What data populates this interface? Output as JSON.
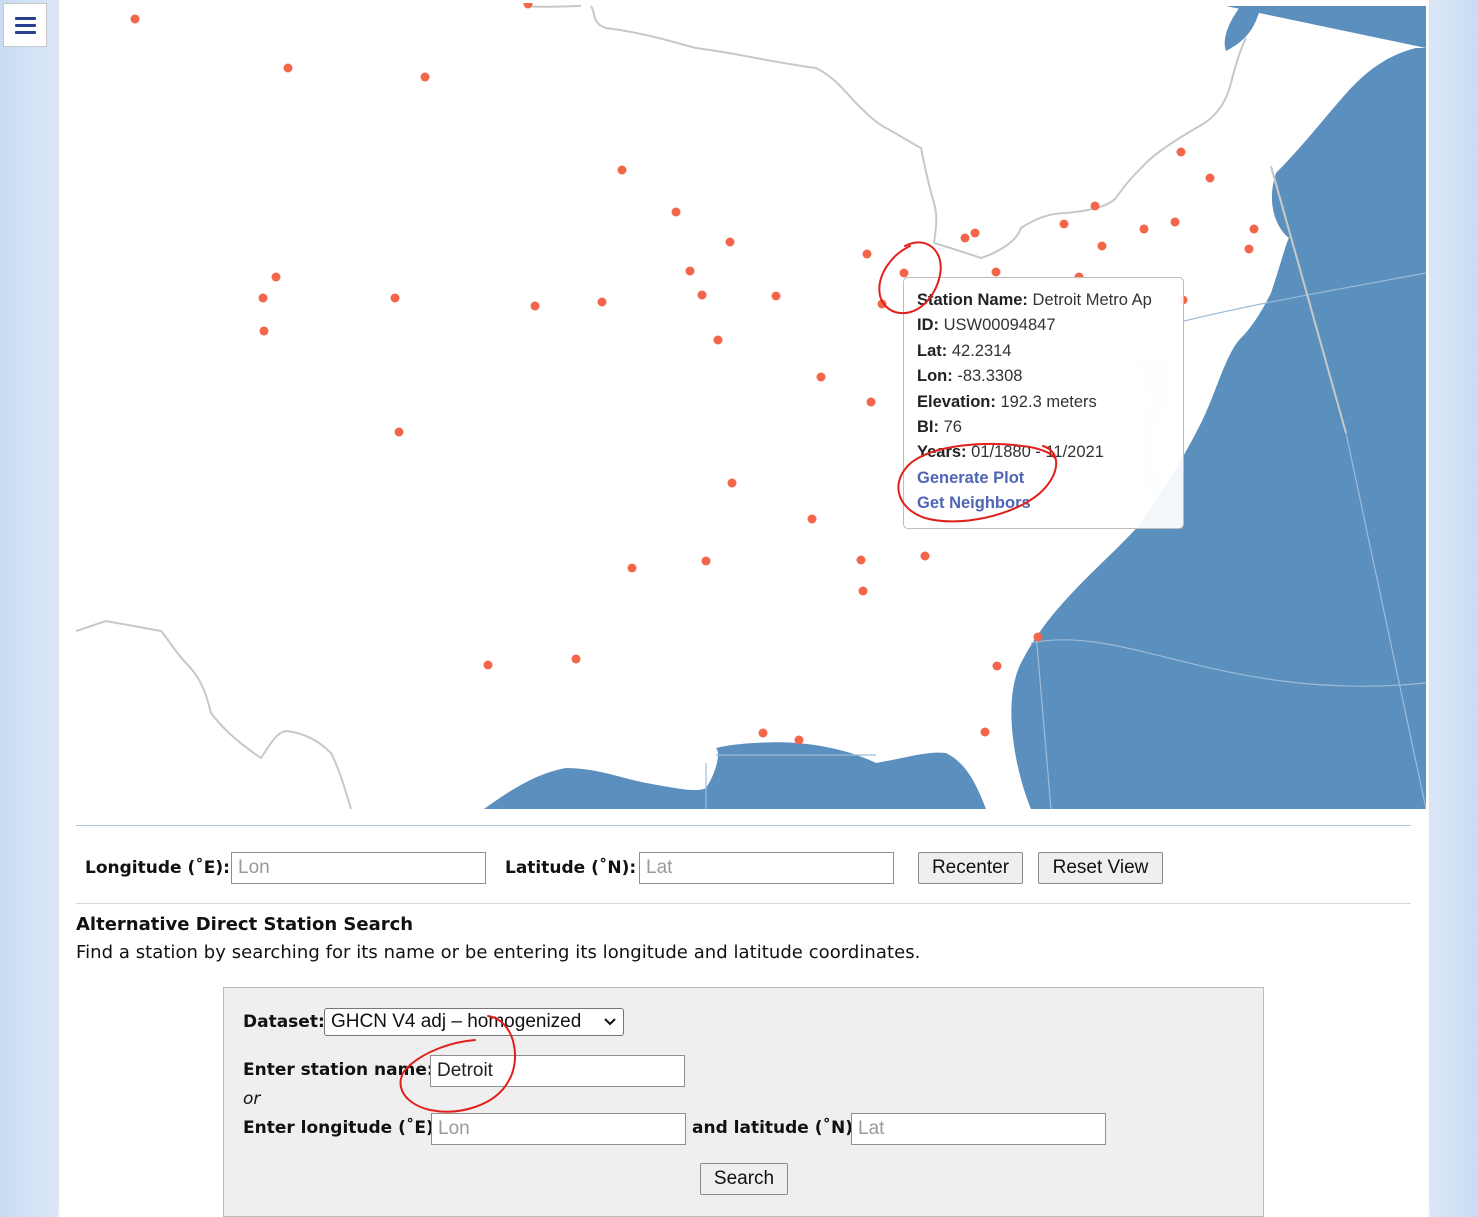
{
  "menu": {
    "icon": "hamburger-menu-icon"
  },
  "map": {
    "land_color": "#ffffff",
    "water_color": "#5b8fbe",
    "border_color": "#c8c8c8",
    "station_color": "#f4664a",
    "popup": {
      "station_name_label": "Station Name:",
      "station_name": "Detroit Metro Ap",
      "id_label": "ID:",
      "id": "USW00094847",
      "lat_label": "Lat:",
      "lat": "42.2314",
      "lon_label": "Lon:",
      "lon": "-83.3308",
      "elevation_label": "Elevation:",
      "elevation": "192.3 meters",
      "bi_label": "BI:",
      "bi": "76",
      "years_label": "Years:",
      "years": "01/1880 - 11/2021",
      "generate_plot": "Generate Plot",
      "get_neighbors": "Get Neighbors"
    }
  },
  "recenter_form": {
    "lon_label": "Longitude (˚E):",
    "lon_placeholder": "Lon",
    "lat_label": "Latitude (˚N):",
    "lat_placeholder": "Lat",
    "recenter": "Recenter",
    "reset_view": "Reset View"
  },
  "alt_search": {
    "title": "Alternative Direct Station Search",
    "description": "Find a station by searching for its name or be entering its longitude and latitude coordinates.",
    "dataset_label": "Dataset:",
    "dataset_value": "GHCN V4 adj – homogenized",
    "name_label": "Enter station name:",
    "name_value": "Detroit",
    "or": "or",
    "lon_label": "Enter longitude (˚E)",
    "lon_placeholder": "Lon",
    "and_lat_label": "and latitude (˚N)",
    "lat_placeholder": "Lat",
    "search": "Search"
  },
  "annotation_color": "#e0201b"
}
